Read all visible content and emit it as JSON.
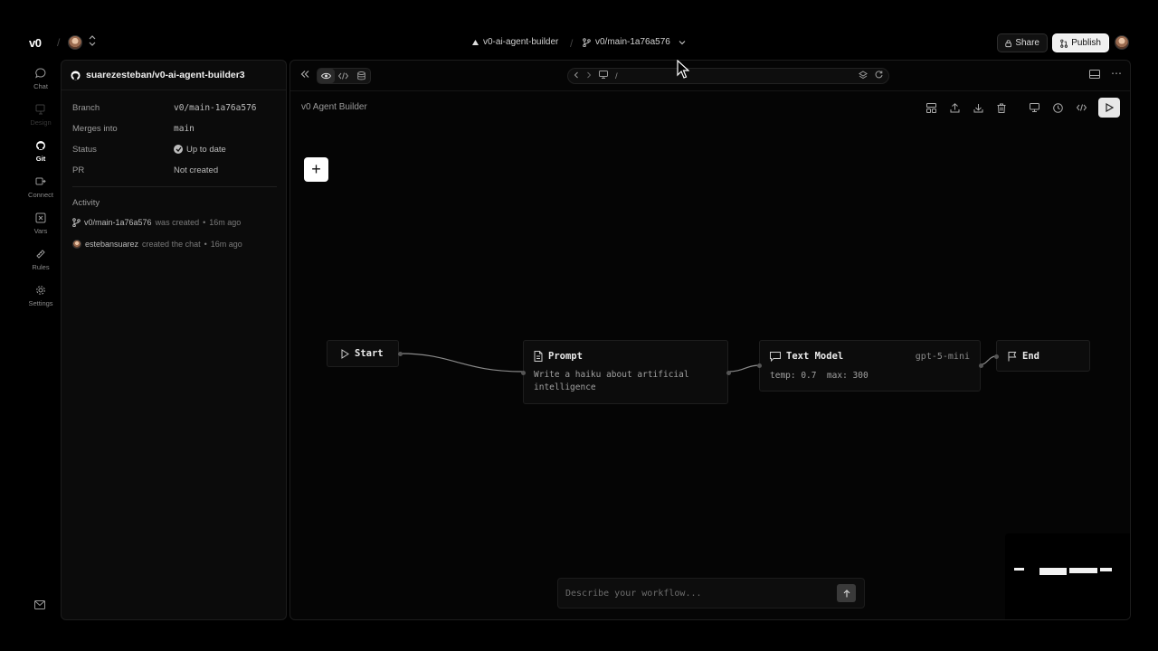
{
  "topbar": {
    "logo": "v0",
    "project": "v0-ai-agent-builder",
    "branch": "v0/main-1a76a576",
    "share_label": "Share",
    "publish_label": "Publish"
  },
  "rail": {
    "items": [
      {
        "label": "Chat",
        "icon": "chat-bubble-icon"
      },
      {
        "label": "Design",
        "icon": "design-icon"
      },
      {
        "label": "Git",
        "icon": "github-icon"
      },
      {
        "label": "Connect",
        "icon": "connect-icon"
      },
      {
        "label": "Vars",
        "icon": "variables-icon"
      },
      {
        "label": "Rules",
        "icon": "rules-icon"
      },
      {
        "label": "Settings",
        "icon": "gear-icon"
      }
    ]
  },
  "git": {
    "repo": "suarezesteban/v0-ai-agent-builder3",
    "branch_label": "Branch",
    "branch_value": "v0/main-1a76a576",
    "merges_label": "Merges into",
    "merges_value": "main",
    "status_label": "Status",
    "status_value": "Up to date",
    "pr_label": "PR",
    "pr_value": "Not created",
    "activity_title": "Activity",
    "activity": [
      {
        "subject": "v0/main-1a76a576",
        "action": "was created",
        "time": "16m ago"
      },
      {
        "subject": "estebansuarez",
        "action": "created the chat",
        "time": "16m ago"
      }
    ]
  },
  "canvas": {
    "url_path": "/",
    "title": "v0 Agent Builder",
    "nodes": {
      "start": {
        "label": "Start"
      },
      "prompt": {
        "label": "Prompt",
        "body": "Write a haiku about artificial intelligence"
      },
      "text_model": {
        "label": "Text Model",
        "model": "gpt-5-mini",
        "params": "temp: 0.7  max: 300"
      },
      "end": {
        "label": "End"
      }
    },
    "describe_placeholder": "Describe your workflow..."
  }
}
